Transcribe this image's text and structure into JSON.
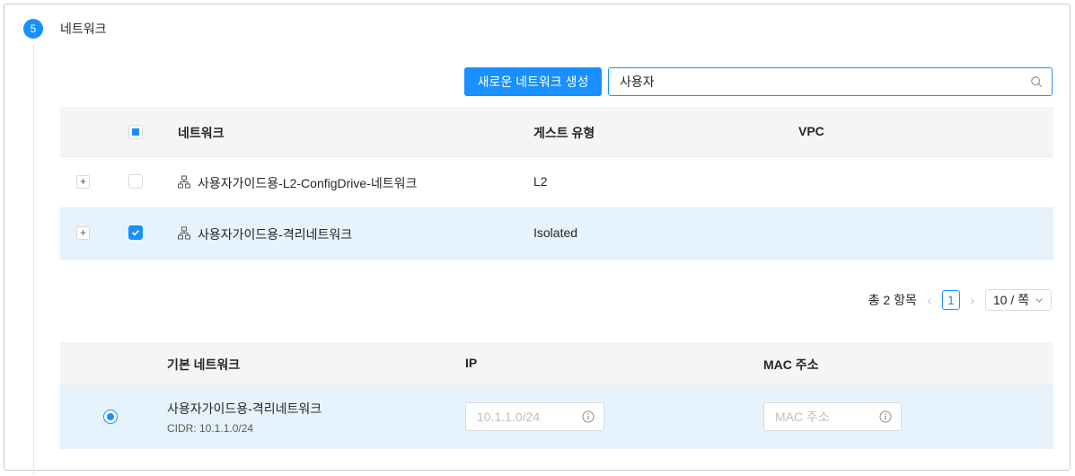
{
  "step": {
    "number": "5",
    "title": "네트워크"
  },
  "toolbar": {
    "create_label": "새로운 네트워크 생성",
    "search_value": "사용자"
  },
  "networks_table": {
    "columns": [
      "네트워크",
      "게스트 유형",
      "VPC"
    ],
    "rows": [
      {
        "name": "사용자가이드용-L2-ConfigDrive-네트워크",
        "guest_type": "L2",
        "vpc": "",
        "checked": false
      },
      {
        "name": "사용자가이드용-격리네트워크",
        "guest_type": "Isolated",
        "vpc": "",
        "checked": true
      }
    ]
  },
  "pagination": {
    "total": "총 2 항목",
    "current": "1",
    "page_size": "10 / 쪽"
  },
  "default_table": {
    "columns": [
      "기본 네트워크",
      "IP",
      "MAC 주소"
    ],
    "row": {
      "name": "사용자가이드용-격리네트워크",
      "cidr": "CIDR: 10.1.1.0/24",
      "ip_placeholder": "10.1.1.0/24",
      "mac_placeholder": "MAC 주소"
    }
  },
  "colors": {
    "accent": "#1890ff",
    "selected_row": "#e6f3fc",
    "header_bg": "#f5f5f5"
  }
}
